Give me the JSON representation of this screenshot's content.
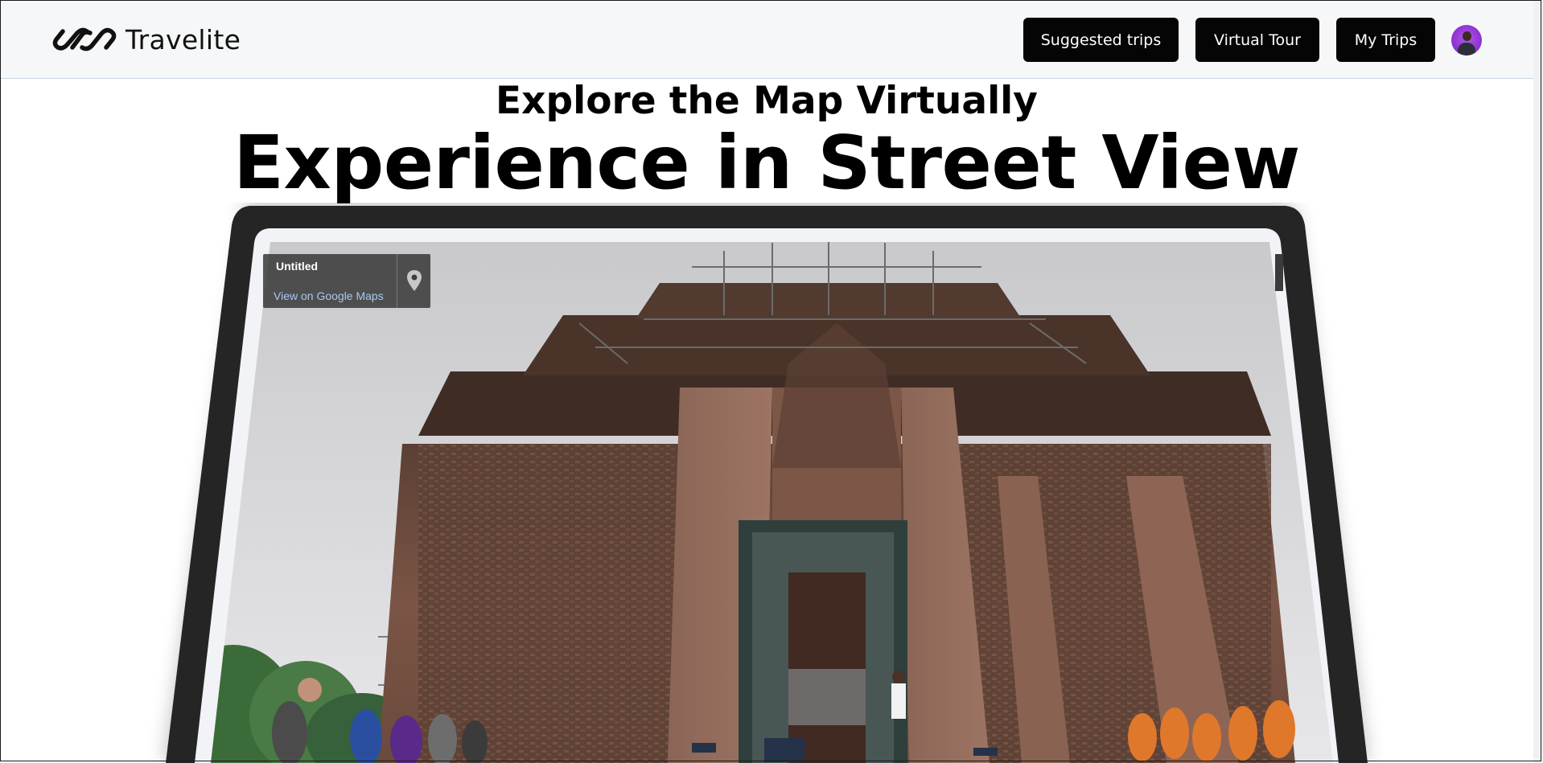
{
  "header": {
    "brand_name": "Travelite",
    "logo_icon": "infinity-links-logo",
    "nav": {
      "suggested_trips": "Suggested trips",
      "virtual_tour": "Virtual Tour",
      "my_trips": "My Trips"
    },
    "avatar_icon": "user-avatar"
  },
  "hero": {
    "subtitle": "Explore the Map Virtually",
    "title": "Experience in Street View"
  },
  "street_view": {
    "title": "Untitled",
    "link_text": "View on Google Maps",
    "pin_icon": "map-pin-icon"
  },
  "colors": {
    "header_bg": "#f6f7f8",
    "button_bg": "#050505",
    "button_text": "#ffffff",
    "avatar_bg": "#8a2fd0",
    "tablet_frame": "#252525"
  }
}
